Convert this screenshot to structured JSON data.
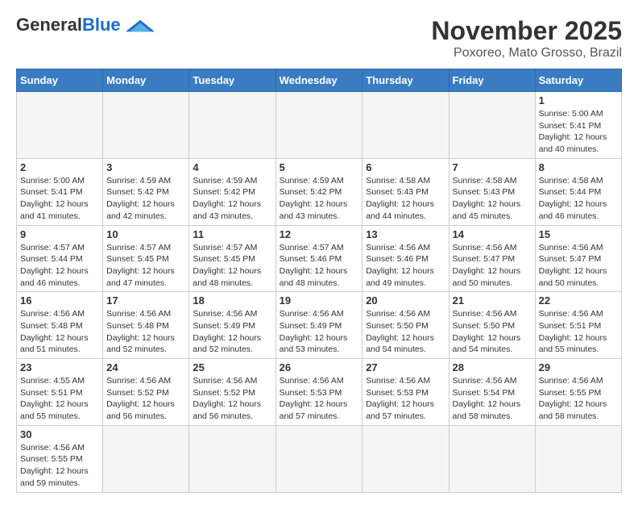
{
  "logo": {
    "text_general": "General",
    "text_blue": "Blue"
  },
  "title": "November 2025",
  "subtitle": "Poxoreo, Mato Grosso, Brazil",
  "days_of_week": [
    "Sunday",
    "Monday",
    "Tuesday",
    "Wednesday",
    "Thursday",
    "Friday",
    "Saturday"
  ],
  "weeks": [
    [
      {
        "day": "",
        "info": ""
      },
      {
        "day": "",
        "info": ""
      },
      {
        "day": "",
        "info": ""
      },
      {
        "day": "",
        "info": ""
      },
      {
        "day": "",
        "info": ""
      },
      {
        "day": "",
        "info": ""
      },
      {
        "day": "1",
        "info": "Sunrise: 5:00 AM\nSunset: 5:41 PM\nDaylight: 12 hours and 40 minutes."
      }
    ],
    [
      {
        "day": "2",
        "info": "Sunrise: 5:00 AM\nSunset: 5:41 PM\nDaylight: 12 hours and 41 minutes."
      },
      {
        "day": "3",
        "info": "Sunrise: 4:59 AM\nSunset: 5:42 PM\nDaylight: 12 hours and 42 minutes."
      },
      {
        "day": "4",
        "info": "Sunrise: 4:59 AM\nSunset: 5:42 PM\nDaylight: 12 hours and 43 minutes."
      },
      {
        "day": "5",
        "info": "Sunrise: 4:59 AM\nSunset: 5:42 PM\nDaylight: 12 hours and 43 minutes."
      },
      {
        "day": "6",
        "info": "Sunrise: 4:58 AM\nSunset: 5:43 PM\nDaylight: 12 hours and 44 minutes."
      },
      {
        "day": "7",
        "info": "Sunrise: 4:58 AM\nSunset: 5:43 PM\nDaylight: 12 hours and 45 minutes."
      },
      {
        "day": "8",
        "info": "Sunrise: 4:58 AM\nSunset: 5:44 PM\nDaylight: 12 hours and 46 minutes."
      }
    ],
    [
      {
        "day": "9",
        "info": "Sunrise: 4:57 AM\nSunset: 5:44 PM\nDaylight: 12 hours and 46 minutes."
      },
      {
        "day": "10",
        "info": "Sunrise: 4:57 AM\nSunset: 5:45 PM\nDaylight: 12 hours and 47 minutes."
      },
      {
        "day": "11",
        "info": "Sunrise: 4:57 AM\nSunset: 5:45 PM\nDaylight: 12 hours and 48 minutes."
      },
      {
        "day": "12",
        "info": "Sunrise: 4:57 AM\nSunset: 5:46 PM\nDaylight: 12 hours and 48 minutes."
      },
      {
        "day": "13",
        "info": "Sunrise: 4:56 AM\nSunset: 5:46 PM\nDaylight: 12 hours and 49 minutes."
      },
      {
        "day": "14",
        "info": "Sunrise: 4:56 AM\nSunset: 5:47 PM\nDaylight: 12 hours and 50 minutes."
      },
      {
        "day": "15",
        "info": "Sunrise: 4:56 AM\nSunset: 5:47 PM\nDaylight: 12 hours and 50 minutes."
      }
    ],
    [
      {
        "day": "16",
        "info": "Sunrise: 4:56 AM\nSunset: 5:48 PM\nDaylight: 12 hours and 51 minutes."
      },
      {
        "day": "17",
        "info": "Sunrise: 4:56 AM\nSunset: 5:48 PM\nDaylight: 12 hours and 52 minutes."
      },
      {
        "day": "18",
        "info": "Sunrise: 4:56 AM\nSunset: 5:49 PM\nDaylight: 12 hours and 52 minutes."
      },
      {
        "day": "19",
        "info": "Sunrise: 4:56 AM\nSunset: 5:49 PM\nDaylight: 12 hours and 53 minutes."
      },
      {
        "day": "20",
        "info": "Sunrise: 4:56 AM\nSunset: 5:50 PM\nDaylight: 12 hours and 54 minutes."
      },
      {
        "day": "21",
        "info": "Sunrise: 4:56 AM\nSunset: 5:50 PM\nDaylight: 12 hours and 54 minutes."
      },
      {
        "day": "22",
        "info": "Sunrise: 4:56 AM\nSunset: 5:51 PM\nDaylight: 12 hours and 55 minutes."
      }
    ],
    [
      {
        "day": "23",
        "info": "Sunrise: 4:55 AM\nSunset: 5:51 PM\nDaylight: 12 hours and 55 minutes."
      },
      {
        "day": "24",
        "info": "Sunrise: 4:56 AM\nSunset: 5:52 PM\nDaylight: 12 hours and 56 minutes."
      },
      {
        "day": "25",
        "info": "Sunrise: 4:56 AM\nSunset: 5:52 PM\nDaylight: 12 hours and 56 minutes."
      },
      {
        "day": "26",
        "info": "Sunrise: 4:56 AM\nSunset: 5:53 PM\nDaylight: 12 hours and 57 minutes."
      },
      {
        "day": "27",
        "info": "Sunrise: 4:56 AM\nSunset: 5:53 PM\nDaylight: 12 hours and 57 minutes."
      },
      {
        "day": "28",
        "info": "Sunrise: 4:56 AM\nSunset: 5:54 PM\nDaylight: 12 hours and 58 minutes."
      },
      {
        "day": "29",
        "info": "Sunrise: 4:56 AM\nSunset: 5:55 PM\nDaylight: 12 hours and 58 minutes."
      }
    ],
    [
      {
        "day": "30",
        "info": "Sunrise: 4:56 AM\nSunset: 5:55 PM\nDaylight: 12 hours and 59 minutes."
      },
      {
        "day": "",
        "info": ""
      },
      {
        "day": "",
        "info": ""
      },
      {
        "day": "",
        "info": ""
      },
      {
        "day": "",
        "info": ""
      },
      {
        "day": "",
        "info": ""
      },
      {
        "day": "",
        "info": ""
      }
    ]
  ]
}
